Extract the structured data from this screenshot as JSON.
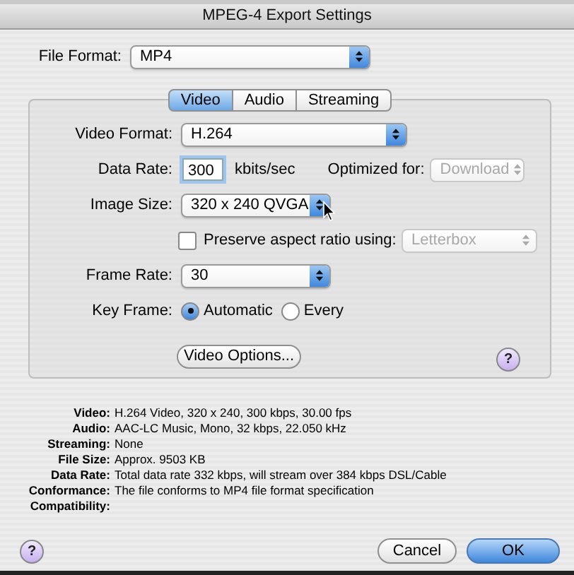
{
  "window": {
    "title": "MPEG-4 Export Settings"
  },
  "file_format": {
    "label": "File Format:",
    "value": "MP4"
  },
  "tabs": [
    {
      "label": "Video",
      "selected": true
    },
    {
      "label": "Audio",
      "selected": false
    },
    {
      "label": "Streaming",
      "selected": false
    }
  ],
  "video_format": {
    "label": "Video Format:",
    "value": "H.264"
  },
  "data_rate": {
    "label": "Data Rate:",
    "value": "300",
    "unit": "kbits/sec"
  },
  "optimized_for": {
    "label": "Optimized for:",
    "value": "Download",
    "disabled": true
  },
  "image_size": {
    "label": "Image Size:",
    "value": "320 x 240 QVGA"
  },
  "preserve_aspect": {
    "label": "Preserve aspect ratio using:",
    "checked": false,
    "value": "Letterbox",
    "disabled": true
  },
  "frame_rate": {
    "label": "Frame Rate:",
    "value": "30"
  },
  "key_frame": {
    "label": "Key Frame:",
    "options": [
      {
        "label": "Automatic",
        "selected": true
      },
      {
        "label": "Every",
        "selected": false
      }
    ]
  },
  "video_options_button": "Video Options...",
  "panel_help": "?",
  "summary": [
    {
      "label": "Video:",
      "value": "H.264 Video, 320 x 240, 300 kbps, 30.00 fps"
    },
    {
      "label": "Audio:",
      "value": "AAC-LC Music, Mono, 32 kbps, 22.050 kHz"
    },
    {
      "label": "Streaming:",
      "value": "None"
    },
    {
      "label": "File Size:",
      "value": "Approx. 9503 KB"
    },
    {
      "label": "Data Rate:",
      "value": "Total data rate 332 kbps, will stream over 384 kbps DSL/Cable"
    },
    {
      "label": "Conformance:",
      "value": "The file conforms to MP4 file format specification"
    },
    {
      "label": "Compatibility:"
    }
  ],
  "window_help": "?",
  "buttons": [
    {
      "label": "Cancel",
      "default": false
    },
    {
      "label": "OK",
      "default": true
    }
  ]
}
